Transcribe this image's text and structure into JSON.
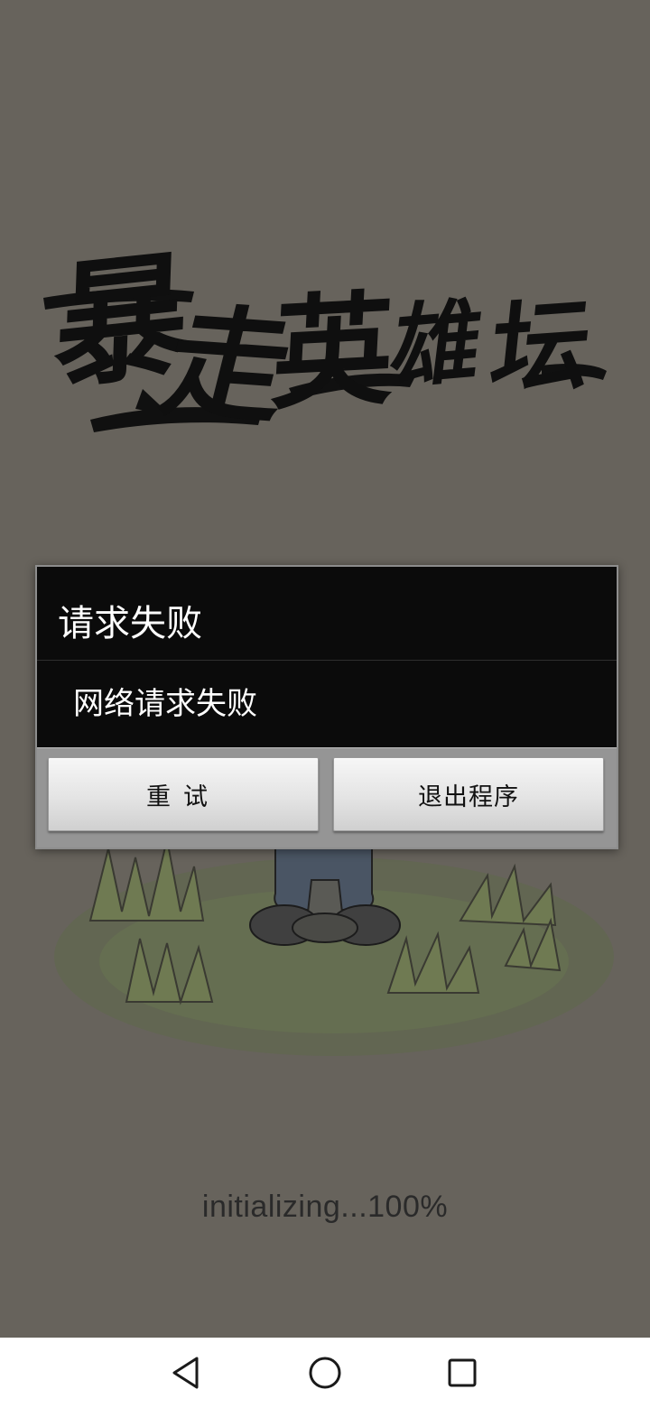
{
  "app": {
    "logo_text": "暴走英雄坛",
    "loading_text": "initializing...100%"
  },
  "dialog": {
    "title": "请求失败",
    "message": "网络请求失败",
    "retry_label": "重试",
    "exit_label": "退出程序"
  },
  "nav": {
    "back_icon": "back-triangle-icon",
    "home_icon": "home-circle-icon",
    "recent_icon": "recent-square-icon"
  },
  "colors": {
    "background": "#67635c",
    "dialog_background": "#0b0b0b",
    "button_bar": "#959595",
    "nav_bar": "#ffffff"
  }
}
